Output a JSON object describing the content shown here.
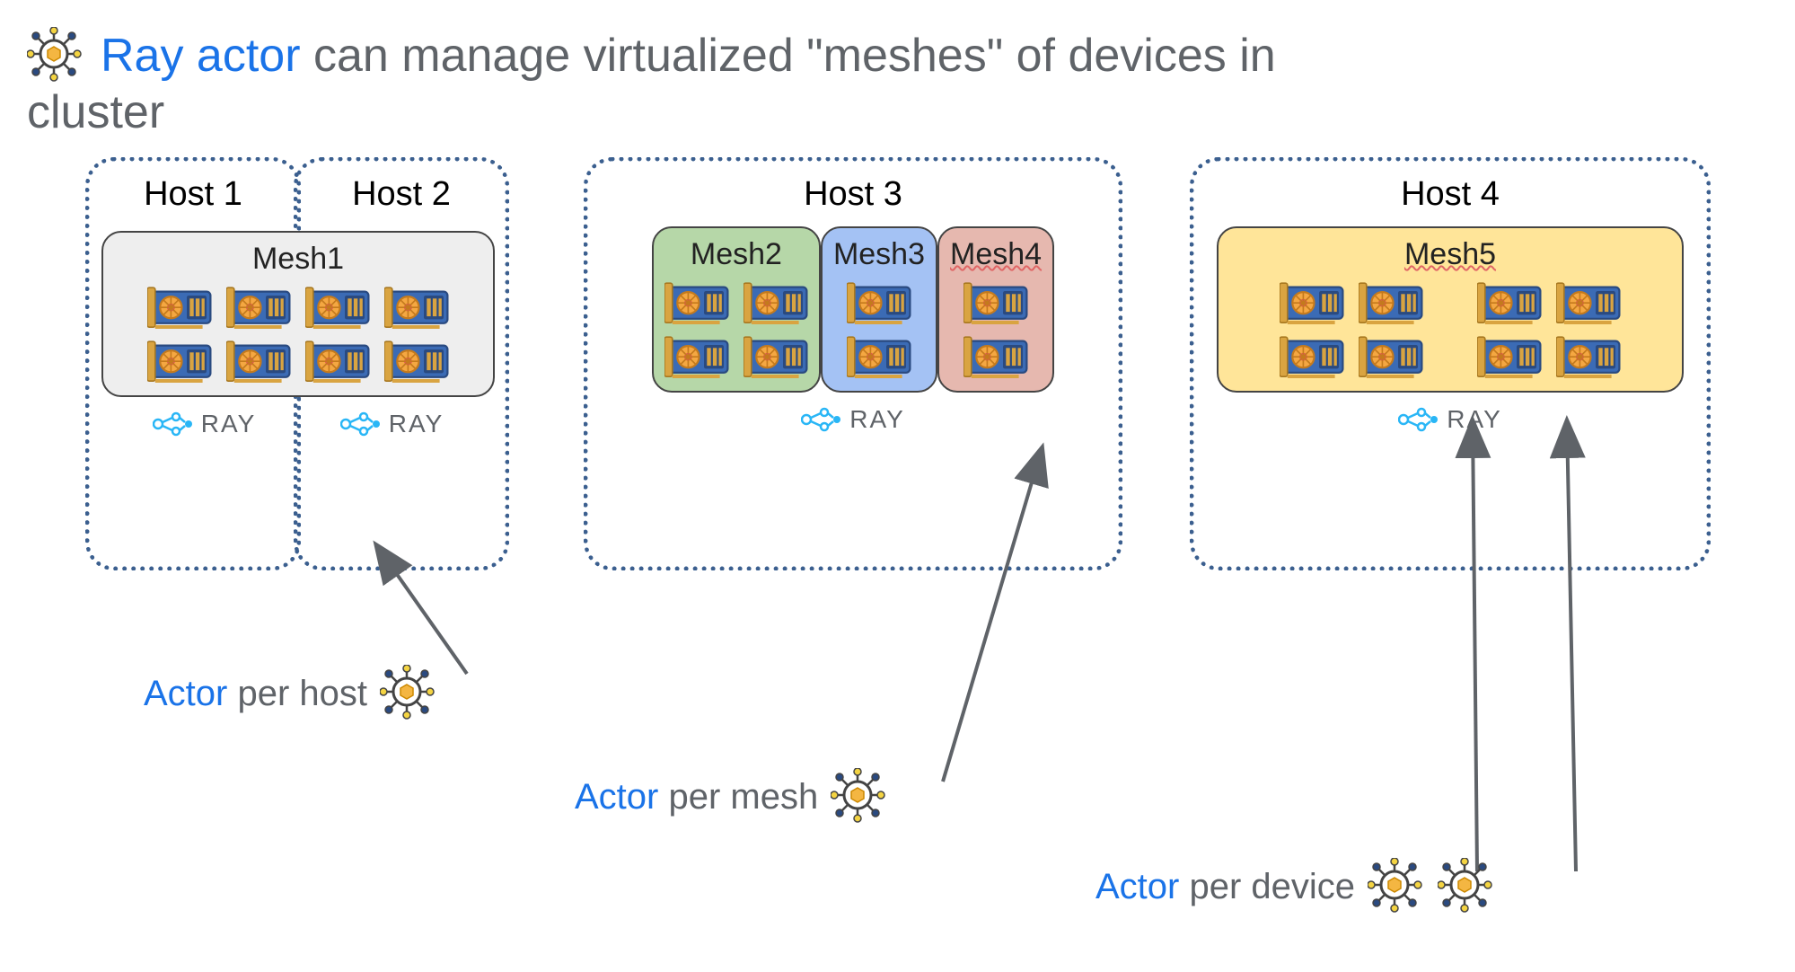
{
  "title": {
    "highlight": "Ray actor",
    "rest1": "can manage virtualized \"meshes\" of devices in",
    "rest2": "cluster"
  },
  "hosts": {
    "h1": "Host 1",
    "h2": "Host 2",
    "h3": "Host 3",
    "h4": "Host 4"
  },
  "meshes": {
    "m1": "Mesh1",
    "m2": "Mesh2",
    "m3": "Mesh3",
    "m4": "Mesh4",
    "m5": "Mesh5"
  },
  "ray_label": "RAY",
  "annotations": {
    "per_host": {
      "actor": "Actor",
      "rest": "per host"
    },
    "per_mesh": {
      "actor": "Actor",
      "rest": "per mesh"
    },
    "per_device": {
      "actor": "Actor",
      "rest": "per device"
    }
  },
  "gpu_counts": {
    "mesh1": 8,
    "mesh2": 4,
    "mesh3": 2,
    "mesh4": 2,
    "mesh5": 8
  }
}
